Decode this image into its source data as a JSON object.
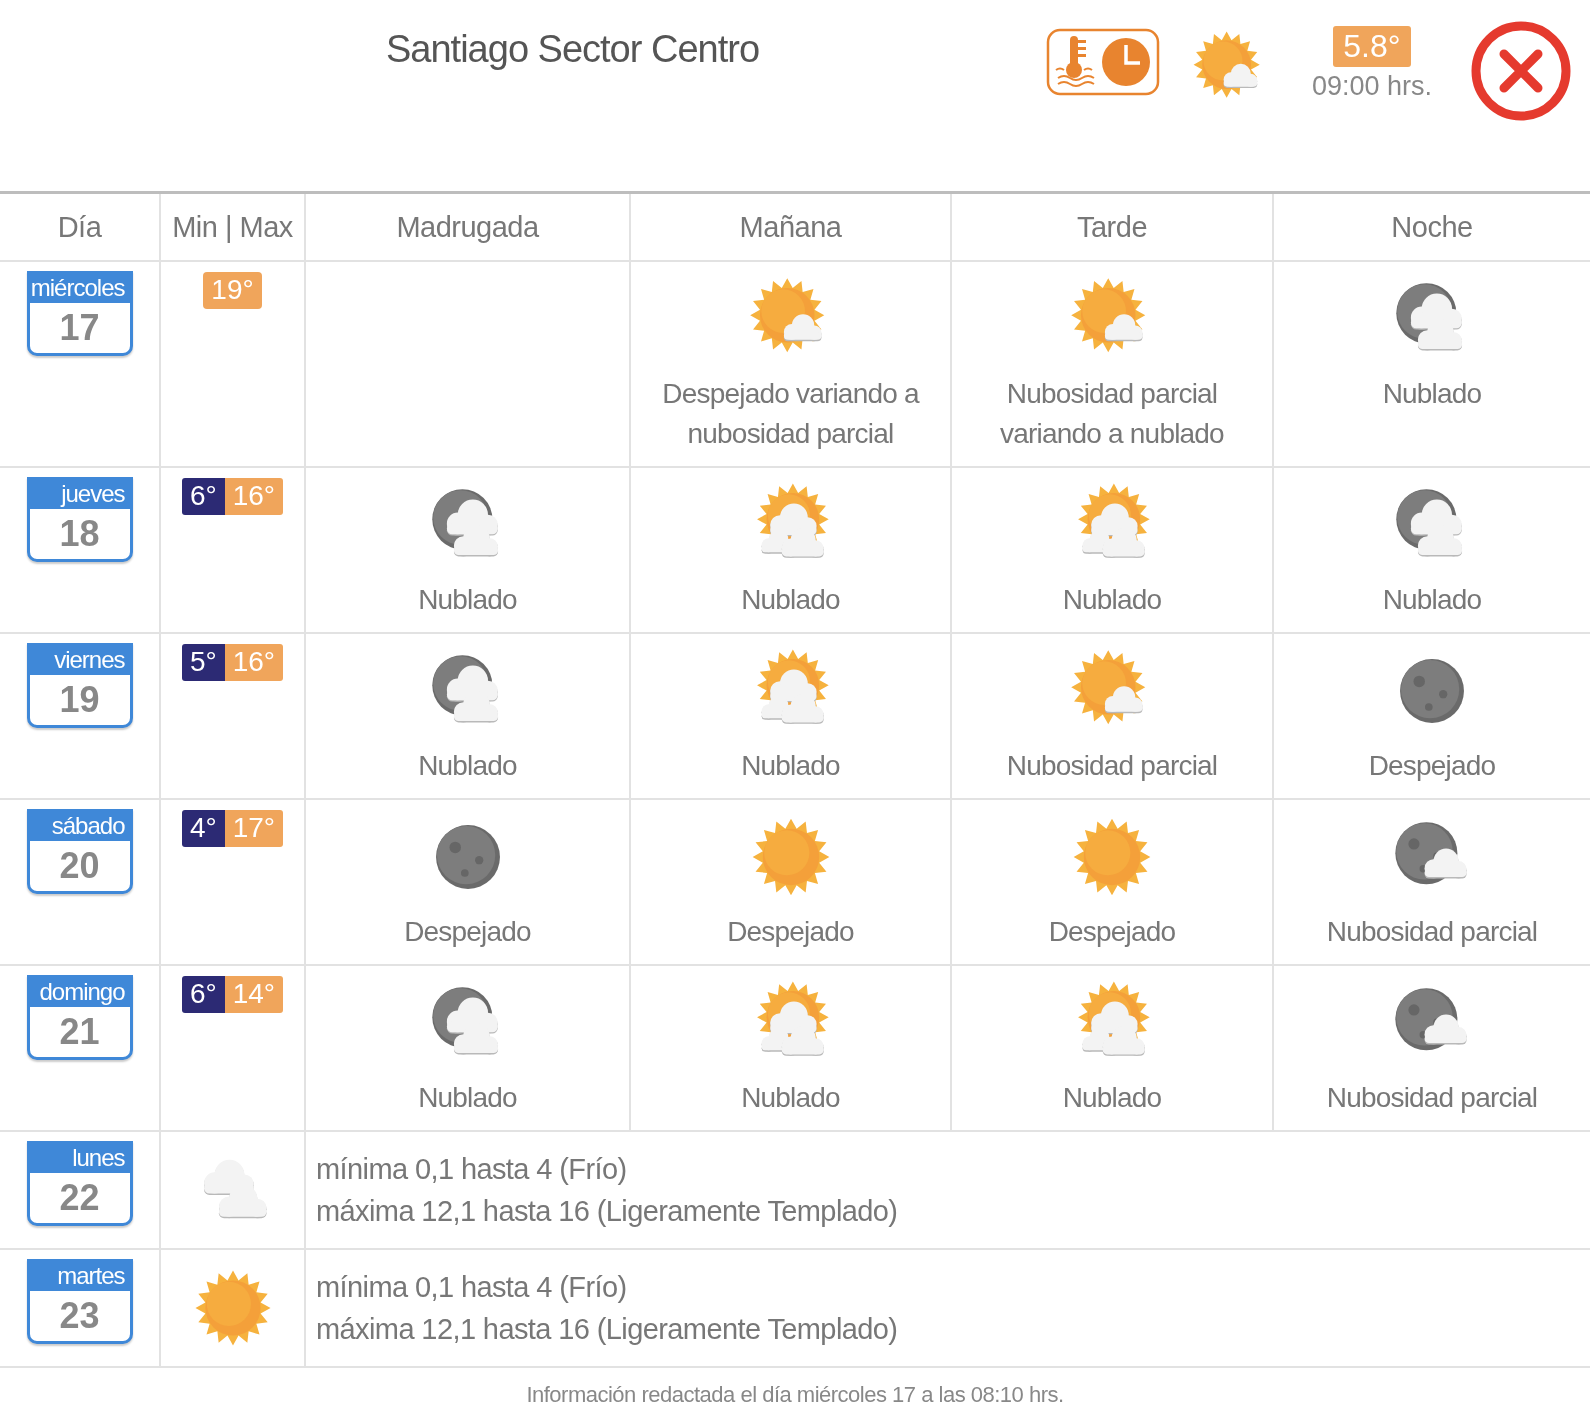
{
  "header": {
    "title": "Santiago Sector Centro",
    "icon": {
      "kind": "sun-cloud"
    },
    "temperature": "5.8°",
    "time": "09:00 hrs."
  },
  "table": {
    "columns": [
      "Día",
      "Min | Max",
      "Madrugada",
      "Mañana",
      "Tarde",
      "Noche"
    ],
    "rows": [
      {
        "kind": "detailed",
        "weekday": "miércoles",
        "day": "17",
        "max": "19°",
        "periods": {
          "manana": {
            "kind": "sun-cloud",
            "text": "Despejado variando a nubosidad parcial"
          },
          "tarde": {
            "kind": "sun-cloud",
            "text": "Nubosidad parcial variando a nublado"
          },
          "noche": {
            "kind": "moon-clouds",
            "text": "Nublado"
          }
        }
      },
      {
        "kind": "detailed",
        "weekday": "jueves",
        "day": "18",
        "min": "6°",
        "max": "16°",
        "periods": {
          "madrugada": {
            "kind": "moon-clouds",
            "text": "Nublado"
          },
          "manana": {
            "kind": "sun-clouds",
            "text": "Nublado"
          },
          "tarde": {
            "kind": "sun-clouds",
            "text": "Nublado"
          },
          "noche": {
            "kind": "moon-clouds",
            "text": "Nublado"
          }
        }
      },
      {
        "kind": "detailed",
        "weekday": "viernes",
        "day": "19",
        "min": "5°",
        "max": "16°",
        "periods": {
          "madrugada": {
            "kind": "moon-clouds",
            "text": "Nublado"
          },
          "manana": {
            "kind": "sun-clouds",
            "text": "Nublado"
          },
          "tarde": {
            "kind": "sun-cloud",
            "text": "Nubosidad parcial"
          },
          "noche": {
            "kind": "moon",
            "text": "Despejado"
          }
        }
      },
      {
        "kind": "detailed",
        "weekday": "sábado",
        "day": "20",
        "min": "4°",
        "max": "17°",
        "periods": {
          "madrugada": {
            "kind": "moon",
            "text": "Despejado"
          },
          "manana": {
            "kind": "sun",
            "text": "Despejado"
          },
          "tarde": {
            "kind": "sun",
            "text": "Despejado"
          },
          "noche": {
            "kind": "moon-cloud",
            "text": "Nubosidad parcial"
          }
        }
      },
      {
        "kind": "detailed",
        "weekday": "domingo",
        "day": "21",
        "min": "6°",
        "max": "14°",
        "periods": {
          "madrugada": {
            "kind": "moon-clouds",
            "text": "Nublado"
          },
          "manana": {
            "kind": "sun-clouds",
            "text": "Nublado"
          },
          "tarde": {
            "kind": "sun-clouds",
            "text": "Nublado"
          },
          "noche": {
            "kind": "moon-cloud",
            "text": "Nubosidad parcial"
          }
        }
      },
      {
        "kind": "summary",
        "weekday": "lunes",
        "day": "22",
        "icon": {
          "kind": "clouds"
        },
        "lines": [
          "mínima 0,1 hasta 4 (Frío)",
          "máxima 12,1 hasta 16 (Ligeramente Templado)"
        ]
      },
      {
        "kind": "summary",
        "weekday": "martes",
        "day": "23",
        "icon": {
          "kind": "sun"
        },
        "lines": [
          "mínima 0,1 hasta 4 (Frío)",
          "máxima 12,1 hasta 16 (Ligeramente Templado)"
        ]
      }
    ]
  },
  "footer": "Información redactada el día miércoles 17 a las 08:10 hrs."
}
